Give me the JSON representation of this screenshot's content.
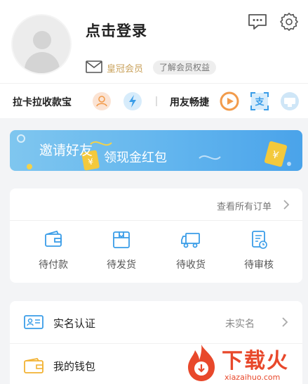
{
  "profile": {
    "login_title": "点击登录",
    "vip_label": "皇冠会员",
    "vip_benefits": "了解会员权益"
  },
  "header_icons": [
    "message-icon",
    "gear-icon"
  ],
  "services": {
    "left_label": "拉卡拉收款宝",
    "right_label": "用友畅捷",
    "left_icons": [
      "person-icon",
      "lightning-icon"
    ],
    "right_icons": [
      "play-icon",
      "alipay-icon",
      "card-icon"
    ]
  },
  "banner": {
    "text_1": "邀请好友",
    "text_2": "领现金红包",
    "icon_glyph": "¥"
  },
  "orders": {
    "all_orders": "查看所有订单",
    "items": [
      {
        "label": "待付款",
        "icon": "wallet-icon"
      },
      {
        "label": "待发货",
        "icon": "box-icon"
      },
      {
        "label": "待收货",
        "icon": "truck-icon"
      },
      {
        "label": "待审核",
        "icon": "review-icon"
      }
    ]
  },
  "menu": {
    "items": [
      {
        "label": "实名认证",
        "value": "未实名",
        "icon": "id-card-icon"
      },
      {
        "label": "我的钱包",
        "value": "",
        "icon": "wallet-icon"
      }
    ]
  },
  "watermark": {
    "text": "下载火",
    "sub": "xiazaihuo.com"
  },
  "colors": {
    "accent": "#4aa3ea",
    "vip_gold": "#c9a25c",
    "orange": "#f29b4b",
    "watermark": "#e8482b"
  }
}
